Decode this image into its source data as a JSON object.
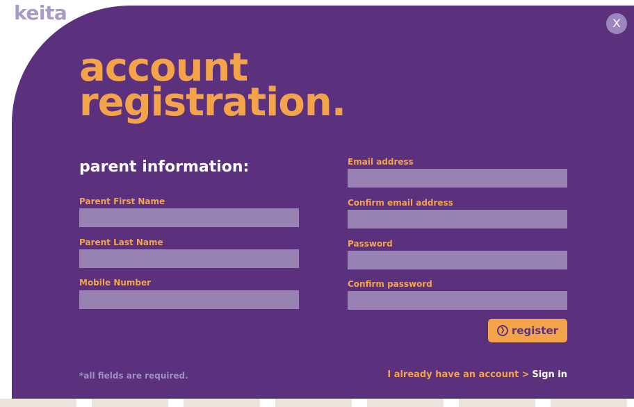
{
  "brand": {
    "logo_text": "keita"
  },
  "close_button": {
    "label": "X"
  },
  "title": {
    "line1": "account",
    "line2": "registration."
  },
  "parent_section": {
    "heading": "parent information:",
    "fields": [
      {
        "label": "Parent First Name",
        "value": ""
      },
      {
        "label": "Parent Last Name",
        "value": ""
      },
      {
        "label": "Mobile Number",
        "value": ""
      }
    ]
  },
  "account_section": {
    "fields": [
      {
        "label": "Email address",
        "value": ""
      },
      {
        "label": "Confirm email address",
        "value": ""
      },
      {
        "label": "Password",
        "value": ""
      },
      {
        "label": "Confirm password",
        "value": ""
      }
    ]
  },
  "register_button": {
    "label": "register",
    "icon": "chevron-right-circle-icon"
  },
  "footer": {
    "required_note": "*all fields are required.",
    "signin_prompt": "I already have an account",
    "signin_separator": ">",
    "signin_link": "Sign in"
  },
  "colors": {
    "panel": "#5b317e",
    "accent": "#f3a34a",
    "input": "#9881b3",
    "logo": "#a99ac7"
  }
}
